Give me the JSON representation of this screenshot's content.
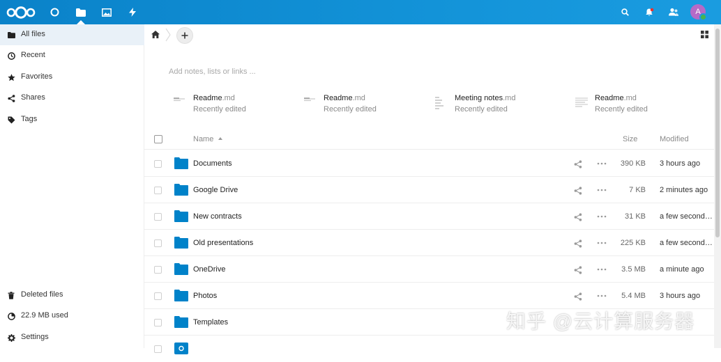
{
  "header": {
    "apps": [
      "dashboard",
      "files",
      "photos",
      "activity"
    ],
    "avatar_initial": "A",
    "accent": "#0082c9"
  },
  "sidebar": {
    "items": [
      {
        "label": "All files",
        "icon": "folder-icon"
      },
      {
        "label": "Recent",
        "icon": "clock-icon"
      },
      {
        "label": "Favorites",
        "icon": "star-icon"
      },
      {
        "label": "Shares",
        "icon": "share-icon"
      },
      {
        "label": "Tags",
        "icon": "tag-icon"
      }
    ],
    "footer": [
      {
        "label": "Deleted files",
        "icon": "trash-icon"
      },
      {
        "label": "22.9 MB used",
        "icon": "quota-icon"
      },
      {
        "label": "Settings",
        "icon": "gear-icon"
      }
    ]
  },
  "main": {
    "notes_placeholder": "Add notes, lists or links ...",
    "recent": [
      {
        "base": "Readme",
        "ext": ".md",
        "sub": "Recently edited"
      },
      {
        "base": "Readme",
        "ext": ".md",
        "sub": "Recently edited"
      },
      {
        "base": "Meeting notes",
        "ext": ".md",
        "sub": "Recently edited"
      },
      {
        "base": "Readme",
        "ext": ".md",
        "sub": "Recently edited"
      }
    ],
    "columns": {
      "name": "Name",
      "size": "Size",
      "modified": "Modified"
    },
    "rows": [
      {
        "name": "Documents",
        "size": "390 KB",
        "modified": "3 hours ago"
      },
      {
        "name": "Google Drive",
        "size": "7 KB",
        "modified": "2 minutes ago"
      },
      {
        "name": "New contracts",
        "size": "31 KB",
        "modified": "a few seconds ago"
      },
      {
        "name": "Old presentations",
        "size": "225 KB",
        "modified": "a few seconds ago"
      },
      {
        "name": "OneDrive",
        "size": "3.5 MB",
        "modified": "a minute ago"
      },
      {
        "name": "Photos",
        "size": "5.4 MB",
        "modified": "3 hours ago"
      },
      {
        "name": "Templates",
        "size": "",
        "modified": ""
      }
    ]
  },
  "watermark": "知乎 @云计算服务器"
}
